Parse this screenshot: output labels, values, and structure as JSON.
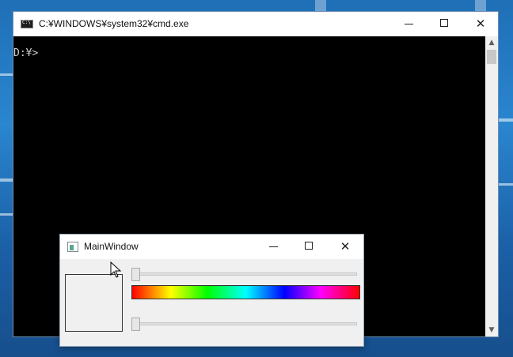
{
  "cmd_window": {
    "title": "C:¥WINDOWS¥system32¥cmd.exe",
    "prompt": "D:¥>",
    "buttons": {
      "minimize": "—",
      "maximize": "□",
      "close": "✕"
    },
    "icons": {
      "app": "console-icon",
      "scroll_up": "chevron-up-icon",
      "scroll_down": "chevron-down-icon"
    }
  },
  "main_window": {
    "title": "MainWindow",
    "buttons": {
      "close": "✕"
    },
    "slider_top_value": 0,
    "slider_bottom_value": 0,
    "swatch_color": "#f0f0f0",
    "icons": {
      "app": "app-window-icon"
    }
  },
  "cursor": {
    "icon": "mouse-pointer-icon"
  }
}
